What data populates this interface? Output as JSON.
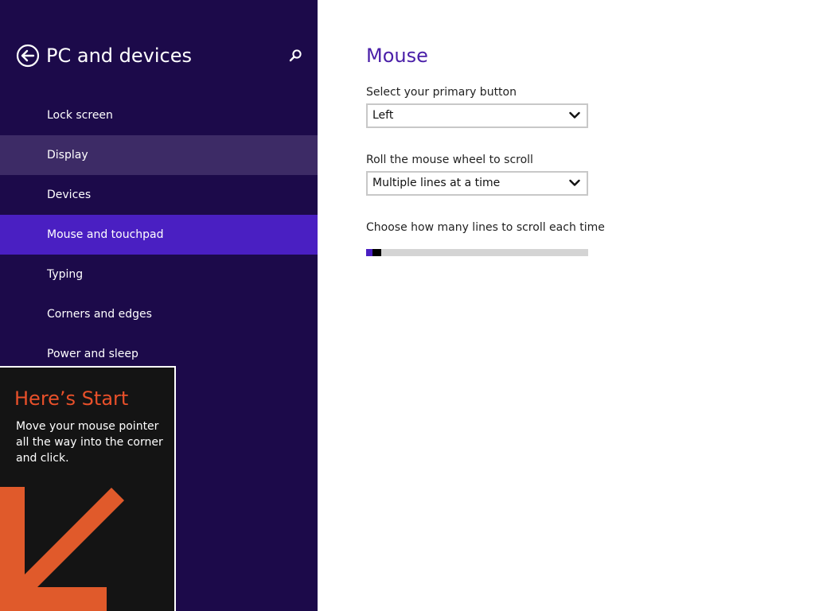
{
  "sidebar": {
    "title": "PC and devices",
    "back_icon": "back-arrow-icon",
    "search_icon": "search-icon",
    "items": [
      {
        "label": "Lock screen",
        "state": "normal"
      },
      {
        "label": "Display",
        "state": "hover"
      },
      {
        "label": "Devices",
        "state": "normal"
      },
      {
        "label": "Mouse and touchpad",
        "state": "selected"
      },
      {
        "label": "Typing",
        "state": "normal"
      },
      {
        "label": "Corners and edges",
        "state": "normal"
      },
      {
        "label": "Power and sleep",
        "state": "normal"
      }
    ]
  },
  "start_tip": {
    "title": "Here’s Start",
    "body": "Move your mouse pointer all the way into the corner and click.",
    "arrow_icon": "down-left-arrow-icon"
  },
  "main": {
    "title": "Mouse",
    "primary_button": {
      "label": "Select your primary button",
      "value": "Left"
    },
    "scroll_mode": {
      "label": "Roll the mouse wheel to scroll",
      "value": "Multiple lines at a time"
    },
    "lines_slider": {
      "label": "Choose how many lines to scroll each time",
      "level": 0.03
    }
  },
  "colors": {
    "sidebar_bg": "#1c0a4a",
    "selected_bg": "#4a1fc2",
    "hover_bg": "#3d2b66",
    "accent_title": "#4a1fa8",
    "tip_title": "#e8502a",
    "tip_arrow": "#e05a2b"
  }
}
